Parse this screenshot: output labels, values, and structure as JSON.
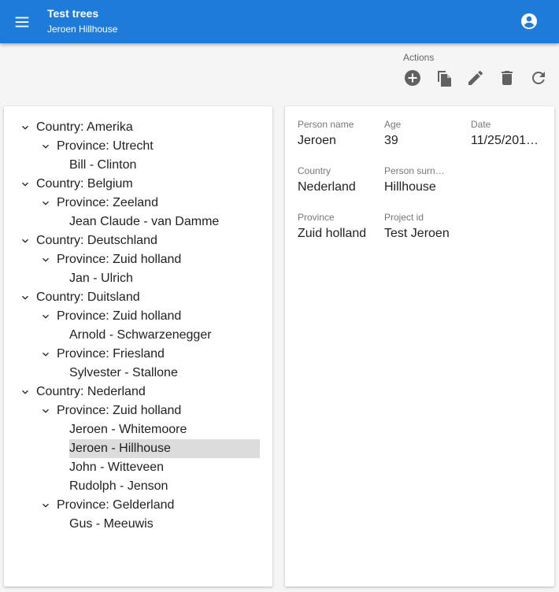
{
  "app": {
    "title": "Test trees",
    "subtitle": "Jeroen Hillhouse",
    "accent_color": "#1e7bd9",
    "icons": {
      "menu": "menu-icon",
      "account": "account-circle-icon"
    }
  },
  "actions": {
    "label": "Actions",
    "buttons": [
      {
        "name": "add",
        "icon": "add-circle-icon"
      },
      {
        "name": "copy",
        "icon": "copy-icon"
      },
      {
        "name": "edit",
        "icon": "pencil-icon"
      },
      {
        "name": "delete",
        "icon": "trash-icon"
      },
      {
        "name": "refresh",
        "icon": "refresh-icon"
      }
    ]
  },
  "tree": {
    "countries": [
      {
        "label": "Country: Amerika",
        "provinces": [
          {
            "label": "Province: Utrecht",
            "persons": [
              "Bill - Clinton"
            ]
          }
        ]
      },
      {
        "label": "Country: Belgium",
        "provinces": [
          {
            "label": "Province: Zeeland",
            "persons": [
              "Jean Claude - van Damme"
            ]
          }
        ]
      },
      {
        "label": "Country: Deutschland",
        "provinces": [
          {
            "label": "Province: Zuid holland",
            "persons": [
              "Jan - Ulrich"
            ]
          }
        ]
      },
      {
        "label": "Country: Duitsland",
        "provinces": [
          {
            "label": "Province: Zuid holland",
            "persons": [
              "Arnold - Schwarzenegger"
            ]
          },
          {
            "label": "Province: Friesland",
            "persons": [
              "Sylvester - Stallone"
            ]
          }
        ]
      },
      {
        "label": "Country: Nederland",
        "provinces": [
          {
            "label": "Province: Zuid holland",
            "persons": [
              "Jeroen - Whitemoore",
              "Jeroen - Hillhouse",
              "John - Witteveen",
              "Rudolph - Jenson"
            ]
          },
          {
            "label": "Province: Gelderland",
            "persons": [
              "Gus - Meeuwis"
            ]
          }
        ]
      }
    ],
    "selected": "Jeroen - Hillhouse"
  },
  "details": {
    "fields": [
      {
        "label": "Person name",
        "value": "Jeroen"
      },
      {
        "label": "Age",
        "value": "39"
      },
      {
        "label": "Date",
        "value": "11/25/201…"
      },
      {
        "label": "Country",
        "value": "Nederland"
      },
      {
        "label": "Person surn…",
        "value": "Hillhouse"
      },
      {
        "label": "Province",
        "value": "Zuid holland"
      },
      {
        "label": "Project id",
        "value": "Test Jeroen"
      }
    ]
  }
}
